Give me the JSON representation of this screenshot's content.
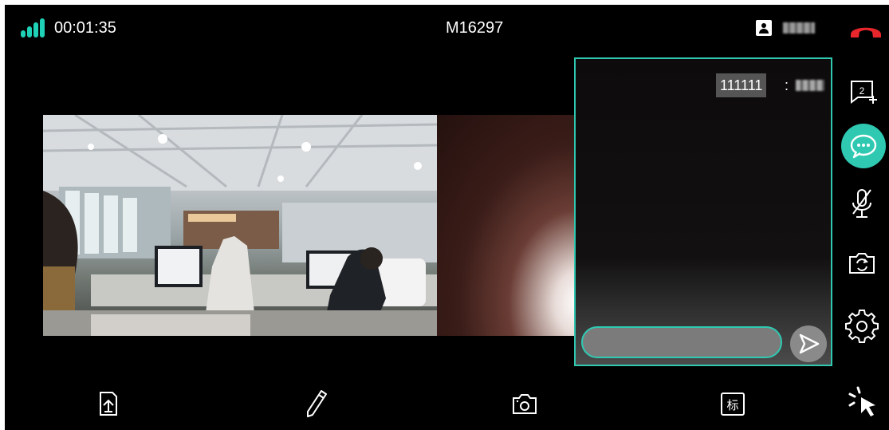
{
  "status": {
    "timer": "00:01:35",
    "room_id": "M16297"
  },
  "chat": {
    "messages": [
      {
        "text": "111111",
        "separator": ":"
      }
    ],
    "input_value": "",
    "input_placeholder": ""
  },
  "side_toolbar": {
    "items": [
      {
        "name": "hang-up",
        "icon": "phone-hangup-icon"
      },
      {
        "name": "new-chat",
        "icon": "message-add-icon",
        "badge": "2"
      },
      {
        "name": "chat",
        "icon": "chat-bubble-icon",
        "active": true
      },
      {
        "name": "mute",
        "icon": "mic-off-icon"
      },
      {
        "name": "switch-camera",
        "icon": "camera-switch-icon"
      },
      {
        "name": "settings",
        "icon": "gear-icon"
      }
    ]
  },
  "bottom_toolbar": {
    "items": [
      {
        "name": "share-file",
        "icon": "upload-file-icon"
      },
      {
        "name": "draw",
        "icon": "pencil-icon"
      },
      {
        "name": "snapshot",
        "icon": "camera-icon"
      },
      {
        "name": "annotate",
        "icon": "label-icon",
        "label": "标"
      },
      {
        "name": "pointer",
        "icon": "pointer-click-icon"
      }
    ]
  },
  "colors": {
    "accent": "#2fc9b2",
    "hangup": "#e8262b",
    "background": "#000000",
    "chat_input_bg": "#7b7b7b"
  }
}
